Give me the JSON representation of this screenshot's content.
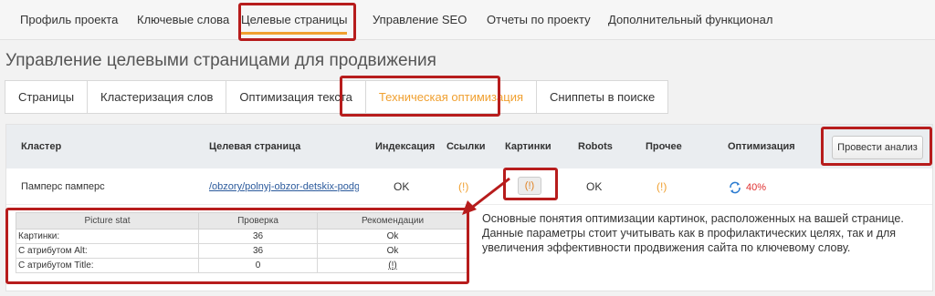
{
  "top_nav": {
    "tabs": [
      {
        "label": "Профиль проекта"
      },
      {
        "label": "Ключевые слова"
      },
      {
        "label": "Целевые страницы"
      },
      {
        "label": "Управление SEO"
      },
      {
        "label": "Отчеты по проекту"
      },
      {
        "label": "Дополнительный функционал"
      }
    ],
    "active_index": 2
  },
  "page_title": "Управление целевыми страницами для продвижения",
  "sub_tabs": {
    "tabs": [
      {
        "label": "Страницы"
      },
      {
        "label": "Кластеризация слов"
      },
      {
        "label": "Оптимизация текста"
      },
      {
        "label": "Техническая оптимизация"
      },
      {
        "label": "Сниппеты в поиске"
      }
    ],
    "active_index": 3
  },
  "table": {
    "headers": {
      "cluster": "Кластер",
      "target_page": "Целевая страница",
      "indexing": "Индексация",
      "links": "Ссылки",
      "images": "Картинки",
      "robots": "Robots",
      "other": "Прочее",
      "optimization": "Оптимизация"
    },
    "analyze_button": "Провести анализ",
    "row": {
      "cluster": "Памперс памперс",
      "target_page": "/obzory/polnyj-obzor-detskix-podgu",
      "indexing": "OK",
      "links": "(!)",
      "images": "(!)",
      "robots": "OK",
      "other": "(!)",
      "optimization_pct": "40%"
    }
  },
  "picture_stat": {
    "headers": [
      "Picture stat",
      "Проверка",
      "Рекомендации"
    ],
    "rows": [
      {
        "label": "Картинки:",
        "value": "36",
        "rec": "Ok"
      },
      {
        "label": "С атрибутом Alt:",
        "value": "36",
        "rec": "Ok"
      },
      {
        "label": "С атрибутом Title:",
        "value": "0",
        "rec": "(!)"
      }
    ]
  },
  "description": "Основные понятия оптимизации картинок, расположенных на вашей странице. Данные параметры стоит учитывать как в профилактических целях, так и для увеличения эффективности продвижения сайта по ключевому слову.",
  "colors": {
    "accent": "#f0a030",
    "highlight_box": "#b71c1c",
    "link": "#2b5a9c",
    "ok": "#2e8b2e",
    "danger": "#e03030"
  }
}
